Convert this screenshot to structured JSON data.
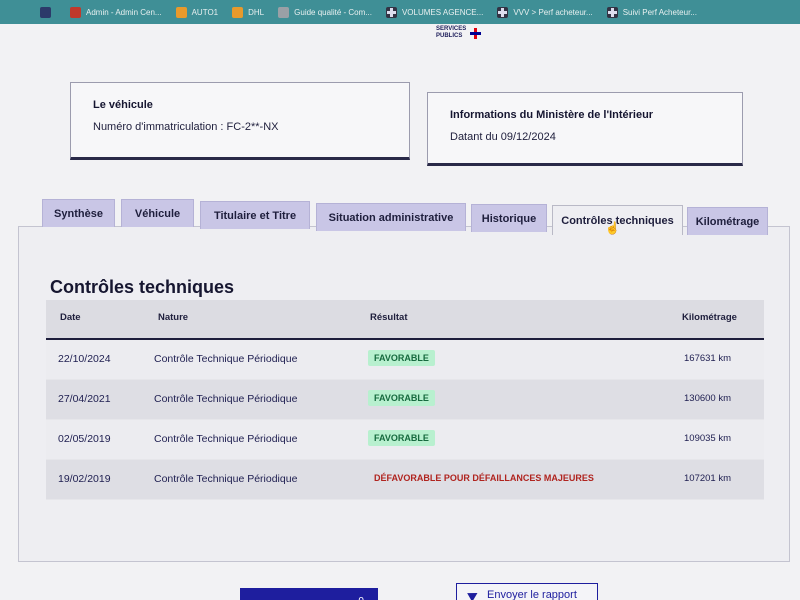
{
  "bookmarks": [
    {
      "label": "",
      "icon": "blue-square-icon"
    },
    {
      "label": "Admin - Admin Cen...",
      "icon": "red-app-icon"
    },
    {
      "label": "AUTO1",
      "icon": "orange-app-icon"
    },
    {
      "label": "DHL",
      "icon": "dhl-icon"
    },
    {
      "label": "Guide qualité - Com...",
      "icon": "document-icon"
    },
    {
      "label": "VOLUMES AGENCE...",
      "icon": "sheet-icon"
    },
    {
      "label": "VVV > Perf acheteur...",
      "icon": "sheet-icon"
    },
    {
      "label": "Suivi Perf Acheteur...",
      "icon": "sheet-icon"
    }
  ],
  "logo": {
    "line1": "SERVICES",
    "line2": "PUBLICS"
  },
  "vehicle_card": {
    "title": "Le véhicule",
    "text": "Numéro d'immatriculation : FC-2**-NX"
  },
  "ministry_card": {
    "title": "Informations du Ministère de l'Intérieur",
    "text": "Datant du 09/12/2024"
  },
  "tabs": [
    "Synthèse",
    "Véhicule",
    "Titulaire et Titre",
    "Situation administrative",
    "Historique",
    "Contrôles techniques",
    "Kilométrage"
  ],
  "active_tab": "Contrôles techniques",
  "section_title": "Contrôles techniques",
  "table": {
    "headers": [
      "Date",
      "Nature",
      "Résultat",
      "Kilométrage"
    ],
    "rows": [
      {
        "date": "22/10/2024",
        "nature": "Contrôle Technique Périodique",
        "result": "FAVORABLE",
        "status": "ok",
        "km": "167631 km"
      },
      {
        "date": "27/04/2021",
        "nature": "Contrôle Technique Périodique",
        "result": "FAVORABLE",
        "status": "ok",
        "km": "130600 km"
      },
      {
        "date": "02/05/2019",
        "nature": "Contrôle Technique Périodique",
        "result": "FAVORABLE",
        "status": "ok",
        "km": "109035 km"
      },
      {
        "date": "19/02/2019",
        "nature": "Contrôle Technique Périodique",
        "result": "DÉFAVORABLE POUR DÉFAILLANCES MAJEURES",
        "status": "ko",
        "km": "107201 km"
      }
    ]
  },
  "buttons": {
    "primary_label": "...0",
    "report_label": "Envoyer le rapport"
  },
  "colors": {
    "accent": "#000091",
    "bookmark_bar": "#3f8f96",
    "tab_bg": "#c9c6e6",
    "favorable_bg": "#b8f0cf",
    "favorable_text": "#166a3e",
    "defavorable_text": "#b0241f"
  }
}
